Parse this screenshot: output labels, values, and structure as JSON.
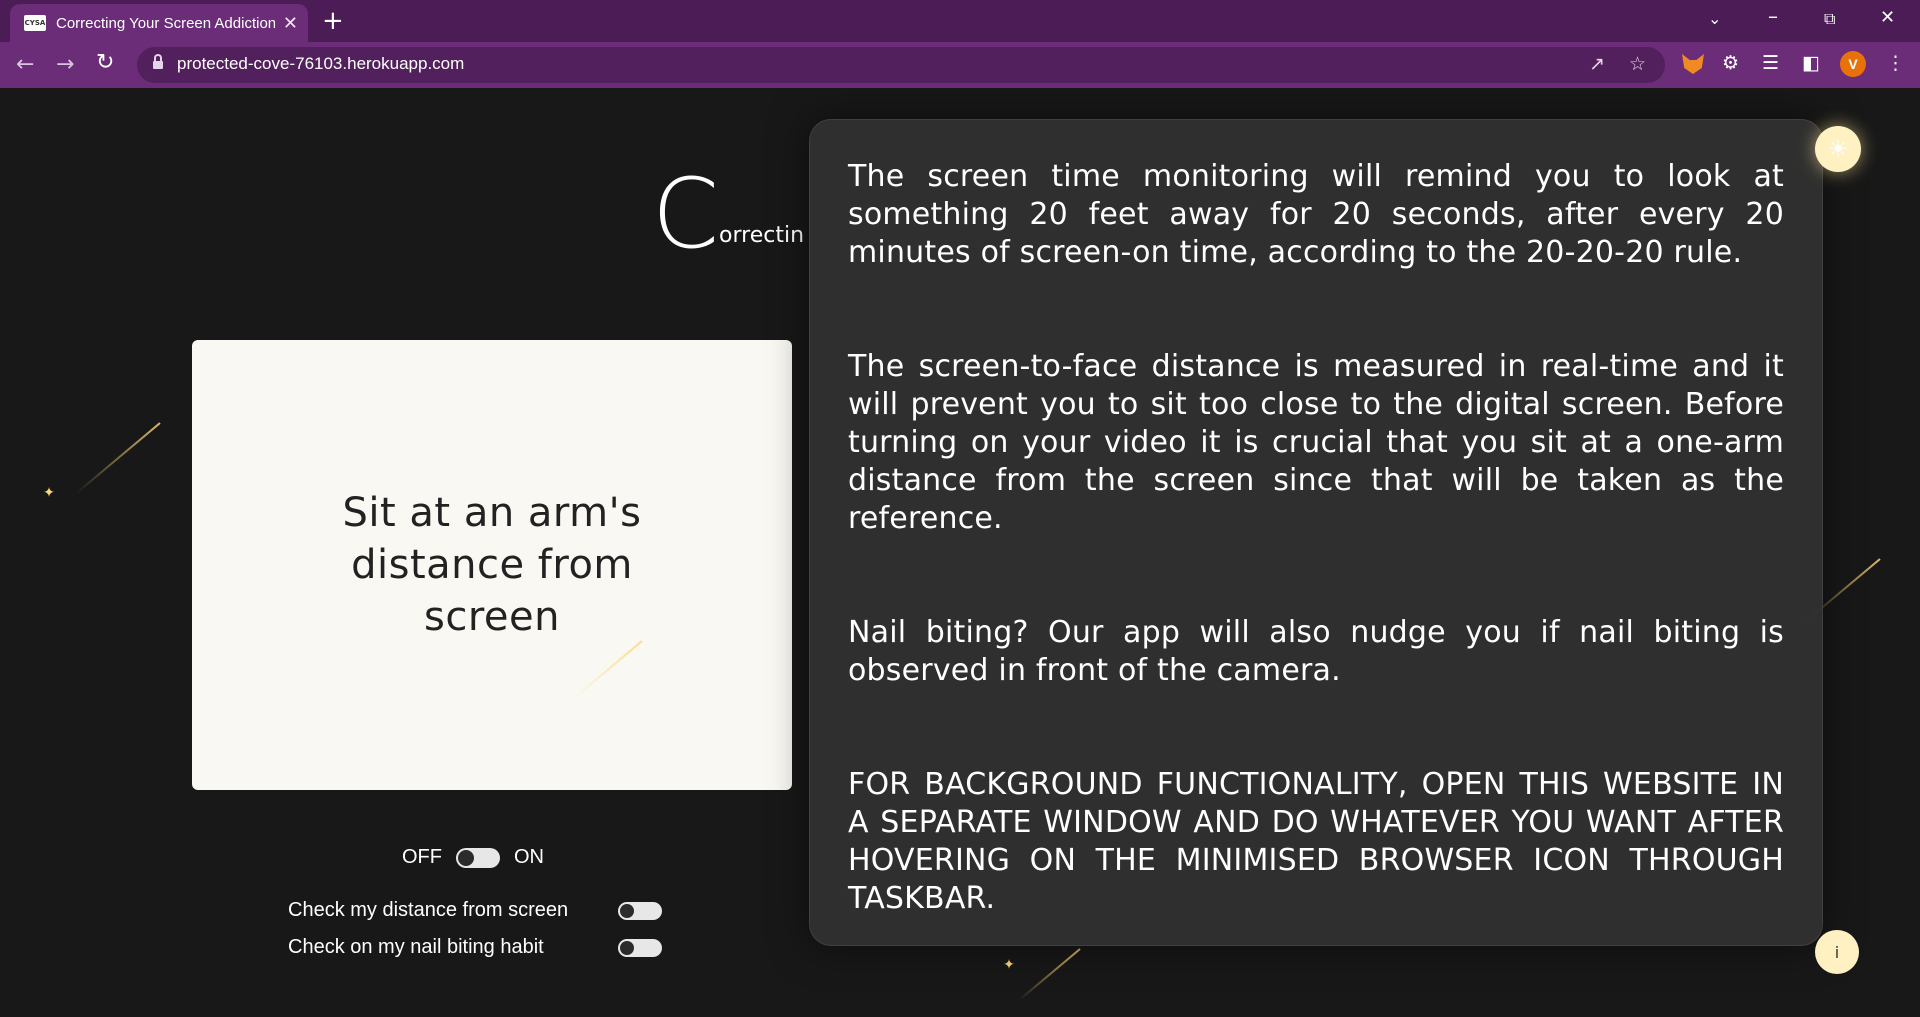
{
  "browser": {
    "tab_favicon_text": "CYSA",
    "tab_title": "Correcting Your Screen Addiction",
    "tab_close": "✕",
    "new_tab": "+",
    "url": "protected-cove-76103.herokuapp.com",
    "profile_initial": "V",
    "icons": [
      "back-arrow-icon",
      "forward-arrow-icon",
      "reload-icon",
      "lock-icon",
      "share-icon",
      "star-icon",
      "metamask-fox-icon",
      "puzzle-extensions-icon",
      "media-queue-icon",
      "side-panel-icon",
      "kebab-menu-icon"
    ]
  },
  "page": {
    "heading_initial": "C",
    "heading_rest": "orrectin",
    "card_text": "Sit at an arm's distance from screen",
    "master_toggle": {
      "off_label": "OFF",
      "on_label": "ON"
    },
    "options": [
      {
        "label": "Check my distance from screen"
      },
      {
        "label": "Check on my nail biting habit"
      }
    ],
    "info": {
      "para1": "The screen time monitoring will remind you to look at something 20 feet away for 20 seconds, after every 20 minutes of screen-on time, according to the 20-20-20 rule.",
      "para2": "The screen-to-face distance is measured in real-time and it will prevent you to sit too close to the digital screen. Before turning on your video it is crucial that you sit at a one-arm distance from the screen since that will be taken as the reference.",
      "para3": "Nail biting? Our app will also nudge you if nail biting is observed in front of the camera.",
      "para4": "FOR BACKGROUND FUNCTIONALITY, OPEN THIS WEBSITE IN A SEPARATE WINDOW AND DO WHATEVER YOU WANT AFTER HOVERING ON THE MINIMISED BROWSER ICON THROUGH TASKBAR."
    },
    "info_button_label": "i",
    "theme_icon": "sun-icon",
    "accent_color": "#fff1c1",
    "browser_color": "#6b2c78"
  }
}
